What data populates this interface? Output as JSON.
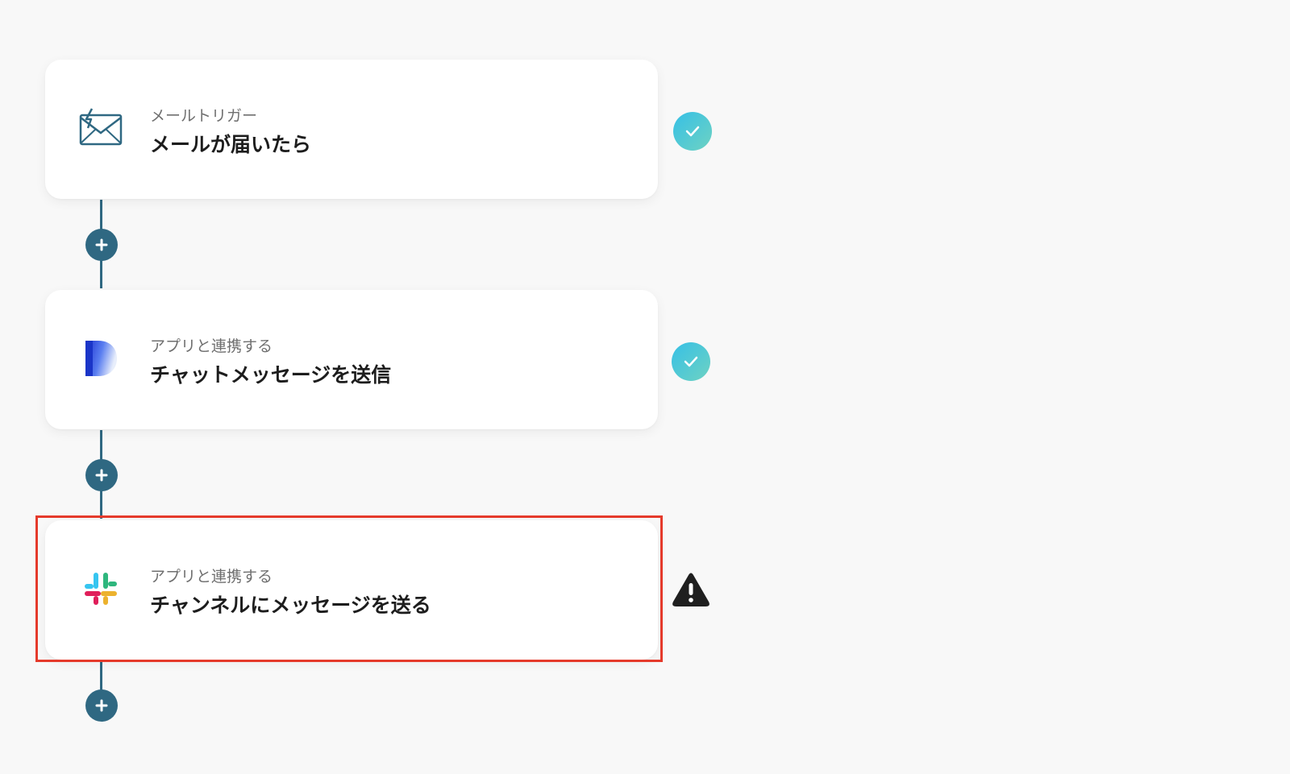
{
  "steps": [
    {
      "icon": "mail-icon",
      "subtitle": "メールトリガー",
      "title": "メールが届いたら",
      "status": "complete"
    },
    {
      "icon": "app-d-logo-icon",
      "subtitle": "アプリと連携する",
      "title": "チャットメッセージを送信",
      "status": "complete"
    },
    {
      "icon": "slack-logo-icon",
      "subtitle": "アプリと連携する",
      "title": "チャンネルにメッセージを送る",
      "status": "warning",
      "highlighted": true
    }
  ],
  "colors": {
    "connector": "#2f6882",
    "check_gradient_start": "#36c0e6",
    "check_gradient_end": "#6ed2c2",
    "highlight_border": "#e53a2b",
    "background": "#f8f8f8"
  }
}
